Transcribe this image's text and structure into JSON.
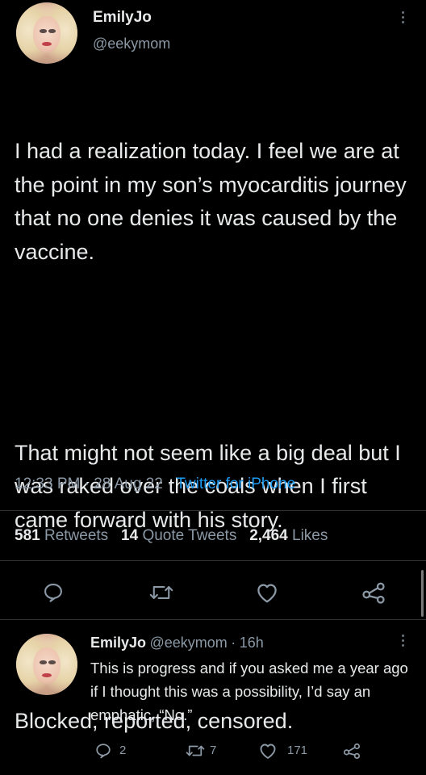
{
  "tweet": {
    "author": {
      "display_name": "EmilyJo",
      "handle": "@eekymom"
    },
    "paragraphs": [
      "I had a realization today. I feel we are at the point in my son’s myocarditis journey that no one denies it was caused by the vaccine.",
      "That might not seem like a big deal but I was raked over the coals when I first came forward with his story.",
      "Blocked, reported, censored."
    ],
    "time": "12:33 PM",
    "date": "28 Aug 22",
    "separator": "·",
    "source": "Twitter for iPhone",
    "stats": {
      "retweets_count": "581",
      "retweets_label": "Retweets",
      "quotes_count": "14",
      "quotes_label": "Quote Tweets",
      "likes_count": "2,464",
      "likes_label": "Likes"
    },
    "actions": [
      "reply-icon",
      "retweet-icon",
      "like-icon",
      "share-icon"
    ]
  },
  "reply": {
    "display_name": "EmilyJo",
    "handle": "@eekymom",
    "separator": "·",
    "age": "16h",
    "text": "This is progress and if you asked me a year ago if I thought this was a possibility, I’d say an emphatic, “No.”",
    "counts": {
      "replies": "2",
      "retweets": "7",
      "likes": "171"
    }
  },
  "colors": {
    "background": "#000000",
    "text_primary": "#e7e9ea",
    "text_secondary": "#8b98a5",
    "link": "#1d9bf0",
    "divider": "#2f3336"
  }
}
